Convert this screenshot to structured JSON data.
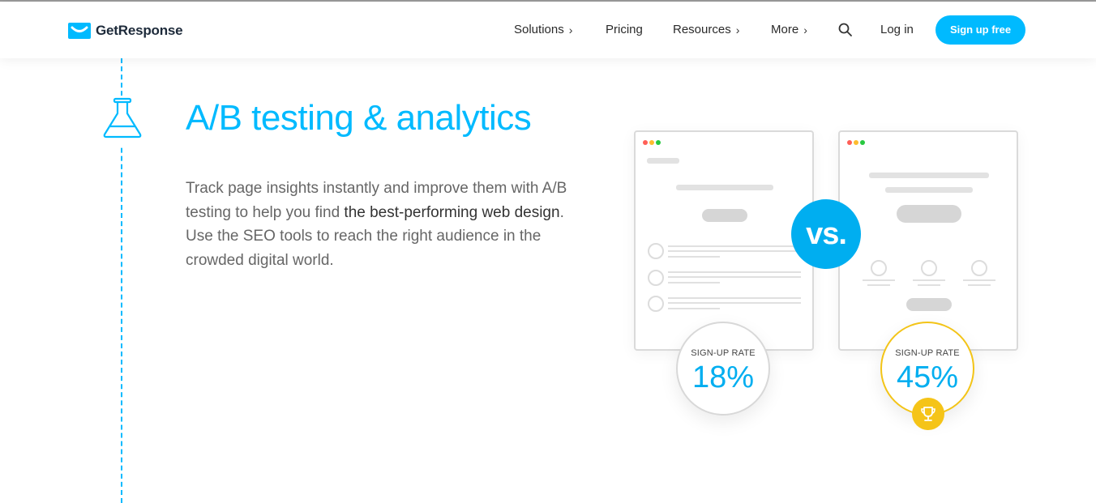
{
  "brand": {
    "name": "GetResponse",
    "color": "#00baff"
  },
  "nav": {
    "items": [
      {
        "label": "Solutions",
        "has_chevron": true
      },
      {
        "label": "Pricing",
        "has_chevron": false
      },
      {
        "label": "Resources",
        "has_chevron": true
      },
      {
        "label": "More",
        "has_chevron": true
      }
    ],
    "chevron": "›",
    "search_icon": "search-icon",
    "login_label": "Log in",
    "signup_label": "Sign up free"
  },
  "section": {
    "icon": "flask-icon",
    "title": "A/B testing & analytics",
    "description_1": "Track page insights instantly and improve them with A/B testing to help you find ",
    "description_strong": "the best-performing web design",
    "description_2": ". Use the SEO tools to reach the right audience in the crowded digital world."
  },
  "comparison": {
    "vs_label": "vs.",
    "variant_a": {
      "rate_label": "SIGN-UP RATE",
      "rate_value": "18%"
    },
    "variant_b": {
      "rate_label": "SIGN-UP RATE",
      "rate_value": "45%",
      "badge_icon": "trophy-icon"
    },
    "colors": {
      "accent": "#00aef0",
      "winner": "#f5c418"
    }
  }
}
